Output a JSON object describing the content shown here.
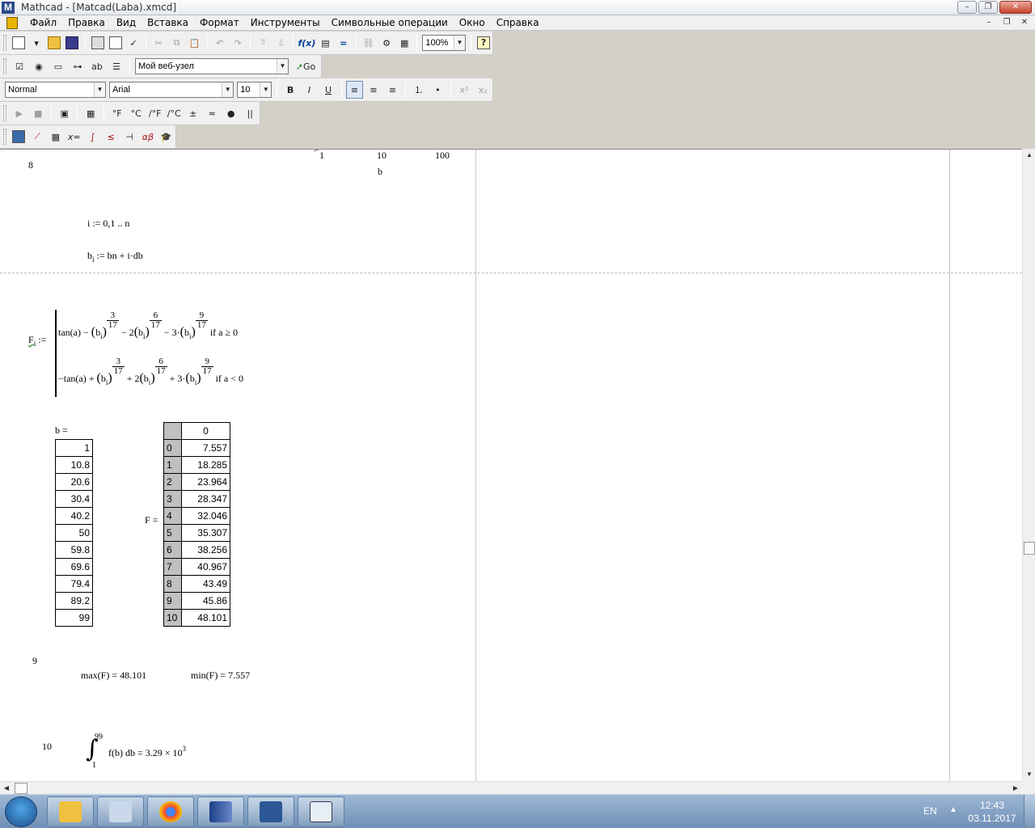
{
  "window": {
    "title": "Mathcad - [Matcad(Laba).xmcd]",
    "controls": [
      "–",
      "❐",
      "✕"
    ],
    "mdi_controls": [
      "–",
      "❐",
      "✕"
    ]
  },
  "menu": [
    "Файл",
    "Правка",
    "Вид",
    "Вставка",
    "Формат",
    "Инструменты",
    "Символьные операции",
    "Окно",
    "Справка"
  ],
  "toolbar_standard": {
    "zoom": "100%"
  },
  "toolbar_resources": {
    "site": "Мой веб-узел",
    "go_label": "Go"
  },
  "toolbar_format": {
    "style": "Normal",
    "font": "Arial",
    "size": "10",
    "bold": "B",
    "italic": "I",
    "underline": "U",
    "superscript": "x²",
    "subscript": "x₂"
  },
  "toolbar_units": [
    "°F",
    "°C",
    "/°F",
    "/°C",
    "±",
    "≈",
    "●",
    "||"
  ],
  "worksheet": {
    "axis_ticks": [
      "1",
      "10",
      "100"
    ],
    "axis_label": "b",
    "section_8": "8",
    "range_def": "i := 0,1 .. n",
    "b_def_lhs": "b",
    "b_def_sub": "i",
    "b_def_rhs": " := bn + i·db",
    "F_lhs": "F",
    "F_sub": "i",
    "assign": ":=",
    "branch1": {
      "tan": "tan(a) − ",
      "f1_num": "3",
      "f1_den": "17",
      "mid1": " − 2",
      "f2_num": "6",
      "f2_den": "17",
      "mid2": " − 3·",
      "f3_num": "9",
      "f3_den": "17",
      "cond": "  if  a ≥ 0"
    },
    "branch2": {
      "tan": "−tan(a) + ",
      "f1_num": "3",
      "f1_den": "17",
      "mid1": " + 2",
      "f2_num": "6",
      "f2_den": "17",
      "mid2": " + 3·",
      "f3_num": "9",
      "f3_den": "17",
      "cond": "  if  a < 0"
    },
    "bi_b": "(b",
    "bi_i": "i",
    "bi_close": ")",
    "b_eq": "b =",
    "b_values": [
      "1",
      "10.8",
      "20.6",
      "30.4",
      "40.2",
      "50",
      "59.8",
      "69.6",
      "79.4",
      "89.2",
      "99"
    ],
    "F_eq": "F =",
    "F_header": "0",
    "F_index": [
      "0",
      "1",
      "2",
      "3",
      "4",
      "5",
      "6",
      "7",
      "8",
      "9",
      "10"
    ],
    "F_values": [
      "7.557",
      "18.285",
      "23.964",
      "28.347",
      "32.046",
      "35.307",
      "38.256",
      "40.967",
      "43.49",
      "45.86",
      "48.101"
    ],
    "section_9": "9",
    "max_expr": "max(F) = 48.101",
    "min_expr": "min(F) = 7.557",
    "section_10": "10",
    "int_upper": "99",
    "int_lower": "1",
    "int_body": "f(b) db = 3.29 × 10",
    "int_exp": "3"
  },
  "taskbar": {
    "lang": "EN",
    "time": "12:43",
    "date": "03.11.2017"
  }
}
